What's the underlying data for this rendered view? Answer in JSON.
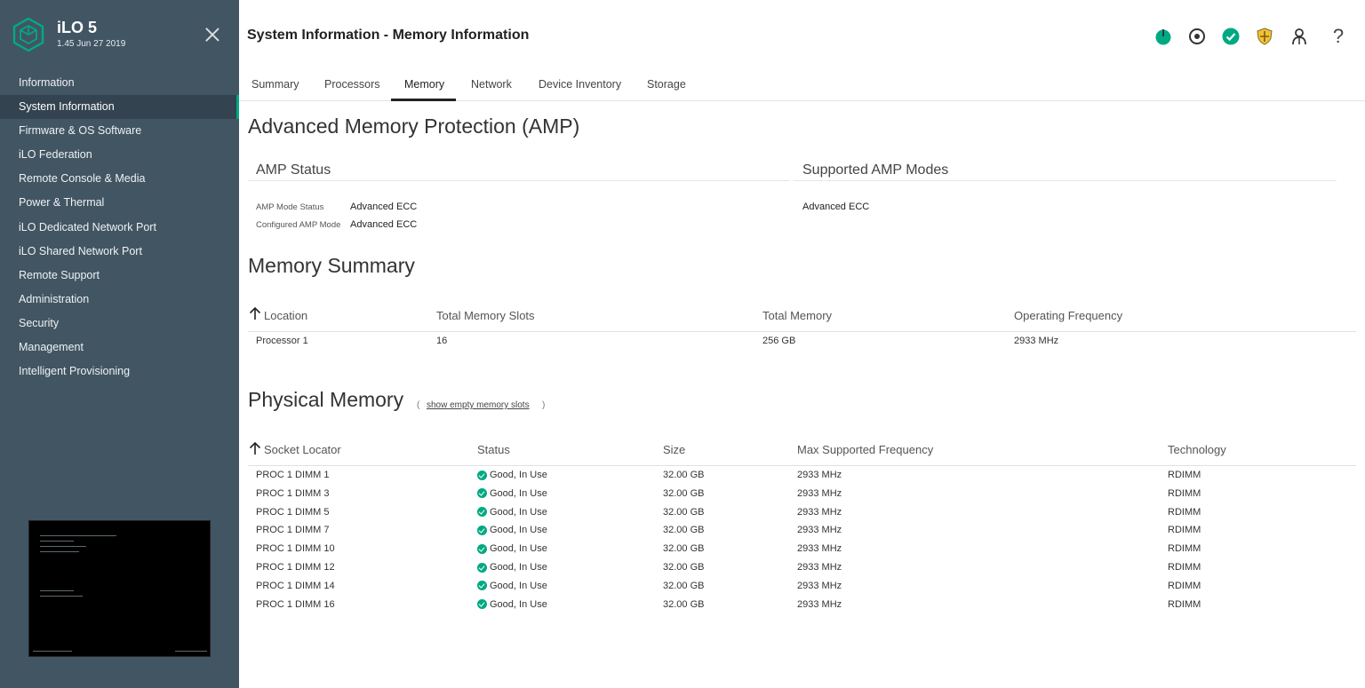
{
  "sidebar": {
    "app_name": "iLO 5",
    "app_version": "1.45 Jun 27 2019",
    "items": [
      {
        "label": "Information"
      },
      {
        "label": "System Information"
      },
      {
        "label": "Firmware & OS Software"
      },
      {
        "label": "iLO Federation"
      },
      {
        "label": "Remote Console & Media"
      },
      {
        "label": "Power & Thermal"
      },
      {
        "label": "iLO Dedicated Network Port"
      },
      {
        "label": "iLO Shared Network Port"
      },
      {
        "label": "Remote Support"
      },
      {
        "label": "Administration"
      },
      {
        "label": "Security"
      },
      {
        "label": "Management"
      },
      {
        "label": "Intelligent Provisioning"
      }
    ],
    "active_item": "System Information"
  },
  "header": {
    "title": "System Information - Memory Information",
    "icons": [
      "power-icon",
      "locator-icon",
      "health-ok-icon",
      "security-shield-icon",
      "user-icon",
      "help-icon"
    ]
  },
  "tabs": [
    {
      "label": "Summary"
    },
    {
      "label": "Processors"
    },
    {
      "label": "Memory"
    },
    {
      "label": "Network"
    },
    {
      "label": "Device Inventory"
    },
    {
      "label": "Storage"
    }
  ],
  "active_tab": "Memory",
  "amp": {
    "title": "Advanced Memory Protection (AMP)",
    "status_heading": "AMP Status",
    "modes_heading": "Supported AMP Modes",
    "mode_status_label": "AMP Mode Status",
    "mode_status_value": "Advanced ECC",
    "configured_label": "Configured AMP Mode",
    "configured_value": "Advanced ECC",
    "supported_modes": [
      "Advanced ECC"
    ]
  },
  "memory_summary": {
    "title": "Memory Summary",
    "columns": [
      "Location",
      "Total Memory Slots",
      "Total Memory",
      "Operating Frequency"
    ],
    "rows": [
      [
        "Processor 1",
        "16",
        "256 GB",
        "2933 MHz"
      ]
    ]
  },
  "physical_memory": {
    "title": "Physical Memory",
    "paren_open": "(",
    "paren_close": ")",
    "toggle_link": "show empty memory slots",
    "columns": [
      "Socket Locator",
      "Status",
      "Size",
      "Max Supported Frequency",
      "Technology"
    ],
    "rows": [
      [
        "PROC 1 DIMM 1",
        "Good, In Use",
        "32.00 GB",
        "2933 MHz",
        "RDIMM"
      ],
      [
        "PROC 1 DIMM 3",
        "Good, In Use",
        "32.00 GB",
        "2933 MHz",
        "RDIMM"
      ],
      [
        "PROC 1 DIMM 5",
        "Good, In Use",
        "32.00 GB",
        "2933 MHz",
        "RDIMM"
      ],
      [
        "PROC 1 DIMM 7",
        "Good, In Use",
        "32.00 GB",
        "2933 MHz",
        "RDIMM"
      ],
      [
        "PROC 1 DIMM 10",
        "Good, In Use",
        "32.00 GB",
        "2933 MHz",
        "RDIMM"
      ],
      [
        "PROC 1 DIMM 12",
        "Good, In Use",
        "32.00 GB",
        "2933 MHz",
        "RDIMM"
      ],
      [
        "PROC 1 DIMM 14",
        "Good, In Use",
        "32.00 GB",
        "2933 MHz",
        "RDIMM"
      ],
      [
        "PROC 1 DIMM 16",
        "Good, In Use",
        "32.00 GB",
        "2933 MHz",
        "RDIMM"
      ]
    ]
  },
  "colors": {
    "sidebar_bg": "#425563",
    "accent": "#01a982",
    "shield": "#f2c230"
  }
}
